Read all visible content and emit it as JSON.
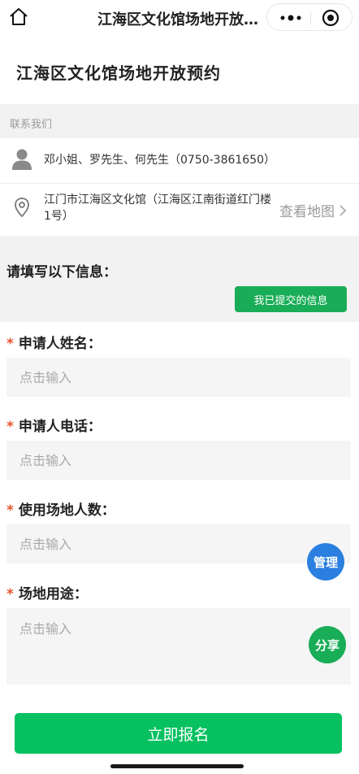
{
  "navbar": {
    "title": "江海区文化馆场地开放预约",
    "home_icon": "home-icon",
    "more_icon": "more-dots-icon",
    "close_icon": "target-close-icon"
  },
  "page": {
    "title": "江海区文化馆场地开放预约"
  },
  "contact": {
    "section_label": "联系我们",
    "people": "邓小姐、罗先生、何先生（0750-3861650）",
    "address": "江门市江海区文化馆（江海区江南街道红门楼1号）",
    "map_link": "查看地图",
    "person_icon": "person-icon",
    "location_icon": "location-pin-icon",
    "chevron_icon": "chevron-right-icon"
  },
  "form": {
    "heading": "请填写以下信息：",
    "my_info_button": "我已提交的信息",
    "required_mark": "*",
    "fields": [
      {
        "label": "申请人姓名：",
        "placeholder": "点击输入"
      },
      {
        "label": "申请人电话：",
        "placeholder": "点击输入"
      },
      {
        "label": "使用场地人数：",
        "placeholder": "点击输入"
      },
      {
        "label": "场地用途：",
        "placeholder": "点击输入"
      }
    ]
  },
  "floating": {
    "manage": "管理",
    "share": "分享"
  },
  "submit": {
    "label": "立即报名"
  },
  "colors": {
    "primary_green": "#07c160",
    "button_green": "#1aad58",
    "manage_blue": "#2b7fe0",
    "required_red": "#e4532d"
  }
}
